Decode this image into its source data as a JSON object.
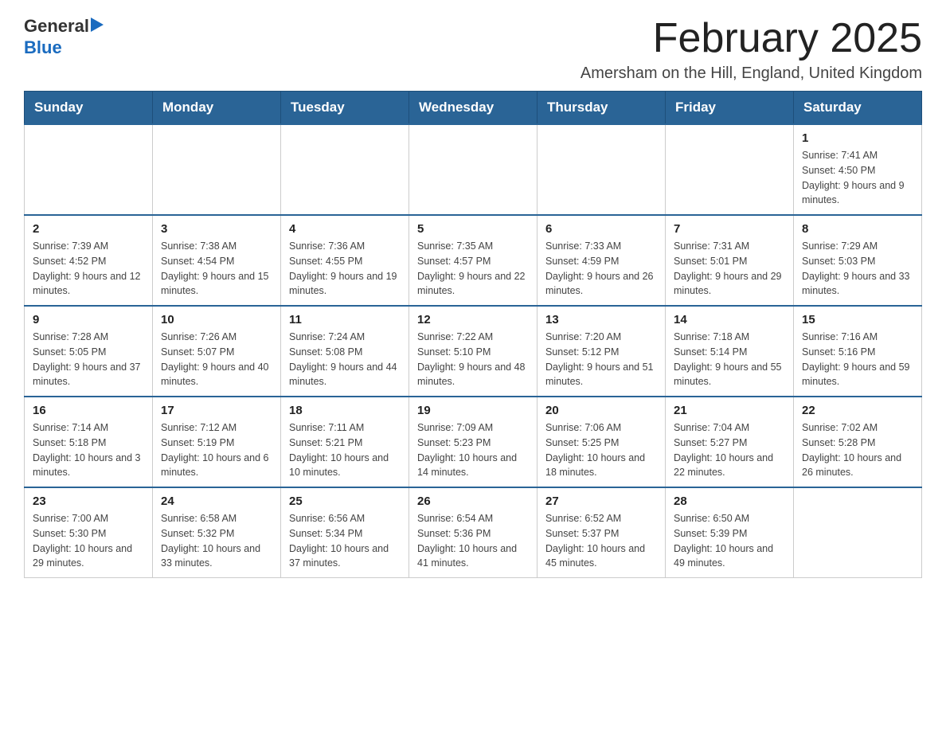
{
  "header": {
    "logo_general": "General",
    "logo_blue": "Blue",
    "month_title": "February 2025",
    "subtitle": "Amersham on the Hill, England, United Kingdom"
  },
  "weekdays": [
    "Sunday",
    "Monday",
    "Tuesday",
    "Wednesday",
    "Thursday",
    "Friday",
    "Saturday"
  ],
  "weeks": [
    [
      {
        "day": "",
        "info": ""
      },
      {
        "day": "",
        "info": ""
      },
      {
        "day": "",
        "info": ""
      },
      {
        "day": "",
        "info": ""
      },
      {
        "day": "",
        "info": ""
      },
      {
        "day": "",
        "info": ""
      },
      {
        "day": "1",
        "info": "Sunrise: 7:41 AM\nSunset: 4:50 PM\nDaylight: 9 hours and 9 minutes."
      }
    ],
    [
      {
        "day": "2",
        "info": "Sunrise: 7:39 AM\nSunset: 4:52 PM\nDaylight: 9 hours and 12 minutes."
      },
      {
        "day": "3",
        "info": "Sunrise: 7:38 AM\nSunset: 4:54 PM\nDaylight: 9 hours and 15 minutes."
      },
      {
        "day": "4",
        "info": "Sunrise: 7:36 AM\nSunset: 4:55 PM\nDaylight: 9 hours and 19 minutes."
      },
      {
        "day": "5",
        "info": "Sunrise: 7:35 AM\nSunset: 4:57 PM\nDaylight: 9 hours and 22 minutes."
      },
      {
        "day": "6",
        "info": "Sunrise: 7:33 AM\nSunset: 4:59 PM\nDaylight: 9 hours and 26 minutes."
      },
      {
        "day": "7",
        "info": "Sunrise: 7:31 AM\nSunset: 5:01 PM\nDaylight: 9 hours and 29 minutes."
      },
      {
        "day": "8",
        "info": "Sunrise: 7:29 AM\nSunset: 5:03 PM\nDaylight: 9 hours and 33 minutes."
      }
    ],
    [
      {
        "day": "9",
        "info": "Sunrise: 7:28 AM\nSunset: 5:05 PM\nDaylight: 9 hours and 37 minutes."
      },
      {
        "day": "10",
        "info": "Sunrise: 7:26 AM\nSunset: 5:07 PM\nDaylight: 9 hours and 40 minutes."
      },
      {
        "day": "11",
        "info": "Sunrise: 7:24 AM\nSunset: 5:08 PM\nDaylight: 9 hours and 44 minutes."
      },
      {
        "day": "12",
        "info": "Sunrise: 7:22 AM\nSunset: 5:10 PM\nDaylight: 9 hours and 48 minutes."
      },
      {
        "day": "13",
        "info": "Sunrise: 7:20 AM\nSunset: 5:12 PM\nDaylight: 9 hours and 51 minutes."
      },
      {
        "day": "14",
        "info": "Sunrise: 7:18 AM\nSunset: 5:14 PM\nDaylight: 9 hours and 55 minutes."
      },
      {
        "day": "15",
        "info": "Sunrise: 7:16 AM\nSunset: 5:16 PM\nDaylight: 9 hours and 59 minutes."
      }
    ],
    [
      {
        "day": "16",
        "info": "Sunrise: 7:14 AM\nSunset: 5:18 PM\nDaylight: 10 hours and 3 minutes."
      },
      {
        "day": "17",
        "info": "Sunrise: 7:12 AM\nSunset: 5:19 PM\nDaylight: 10 hours and 6 minutes."
      },
      {
        "day": "18",
        "info": "Sunrise: 7:11 AM\nSunset: 5:21 PM\nDaylight: 10 hours and 10 minutes."
      },
      {
        "day": "19",
        "info": "Sunrise: 7:09 AM\nSunset: 5:23 PM\nDaylight: 10 hours and 14 minutes."
      },
      {
        "day": "20",
        "info": "Sunrise: 7:06 AM\nSunset: 5:25 PM\nDaylight: 10 hours and 18 minutes."
      },
      {
        "day": "21",
        "info": "Sunrise: 7:04 AM\nSunset: 5:27 PM\nDaylight: 10 hours and 22 minutes."
      },
      {
        "day": "22",
        "info": "Sunrise: 7:02 AM\nSunset: 5:28 PM\nDaylight: 10 hours and 26 minutes."
      }
    ],
    [
      {
        "day": "23",
        "info": "Sunrise: 7:00 AM\nSunset: 5:30 PM\nDaylight: 10 hours and 29 minutes."
      },
      {
        "day": "24",
        "info": "Sunrise: 6:58 AM\nSunset: 5:32 PM\nDaylight: 10 hours and 33 minutes."
      },
      {
        "day": "25",
        "info": "Sunrise: 6:56 AM\nSunset: 5:34 PM\nDaylight: 10 hours and 37 minutes."
      },
      {
        "day": "26",
        "info": "Sunrise: 6:54 AM\nSunset: 5:36 PM\nDaylight: 10 hours and 41 minutes."
      },
      {
        "day": "27",
        "info": "Sunrise: 6:52 AM\nSunset: 5:37 PM\nDaylight: 10 hours and 45 minutes."
      },
      {
        "day": "28",
        "info": "Sunrise: 6:50 AM\nSunset: 5:39 PM\nDaylight: 10 hours and 49 minutes."
      },
      {
        "day": "",
        "info": ""
      }
    ]
  ]
}
